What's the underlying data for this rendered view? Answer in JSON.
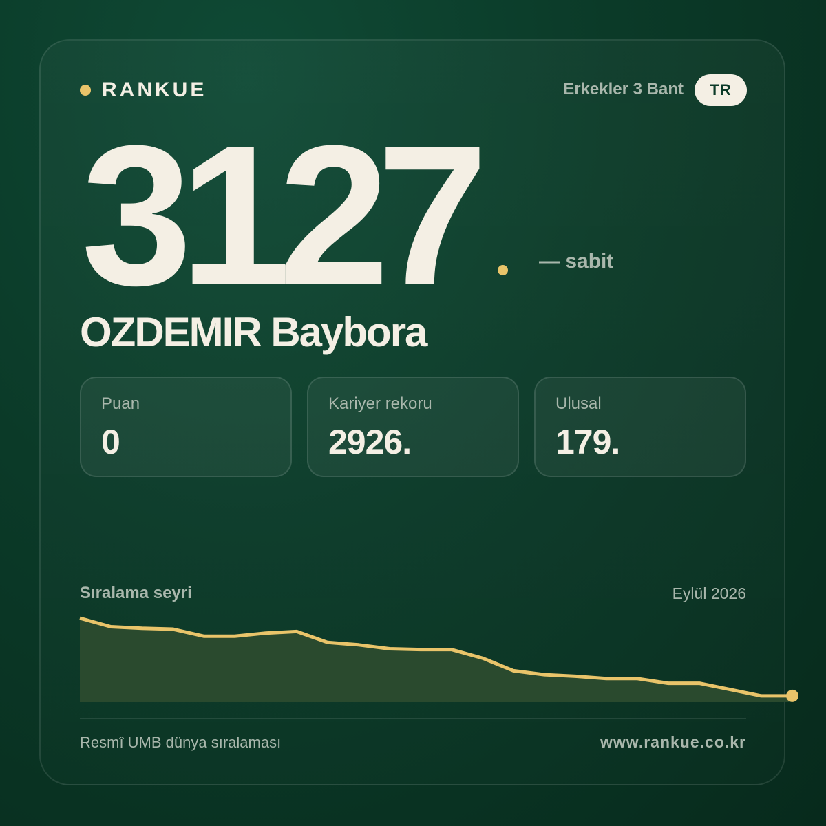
{
  "brand": {
    "name": "RANKUE"
  },
  "header": {
    "category": "Erkekler 3 Bant",
    "country_code": "TR"
  },
  "ranking": {
    "rank": "3127",
    "trend": "— sabit"
  },
  "player": {
    "name": "OZDEMIR Baybora"
  },
  "stats": [
    {
      "label": "Puan",
      "value": "0"
    },
    {
      "label": "Kariyer rekoru",
      "value": "2926."
    },
    {
      "label": "Ulusal",
      "value": "179."
    }
  ],
  "history": {
    "title": "Sıralama seyri",
    "date": "Eylül 2026"
  },
  "footer": {
    "source": "Resmî UMB dünya sıralaması",
    "website": "www.rankue.co.kr"
  },
  "colors": {
    "accent": "#e9c46a",
    "background": "#0b3a28",
    "text": "#f4efe4",
    "muted": "#a9b7ac"
  },
  "chart_data": {
    "type": "area",
    "title": "Sıralama seyri",
    "series": [
      {
        "values": [
          0,
          11,
          13,
          14,
          23,
          23,
          19,
          17,
          31,
          34,
          39,
          40,
          40,
          51,
          67,
          72,
          74,
          77,
          77,
          83,
          83,
          91,
          99,
          99
        ]
      }
    ],
    "grid": false,
    "legend": "none"
  }
}
